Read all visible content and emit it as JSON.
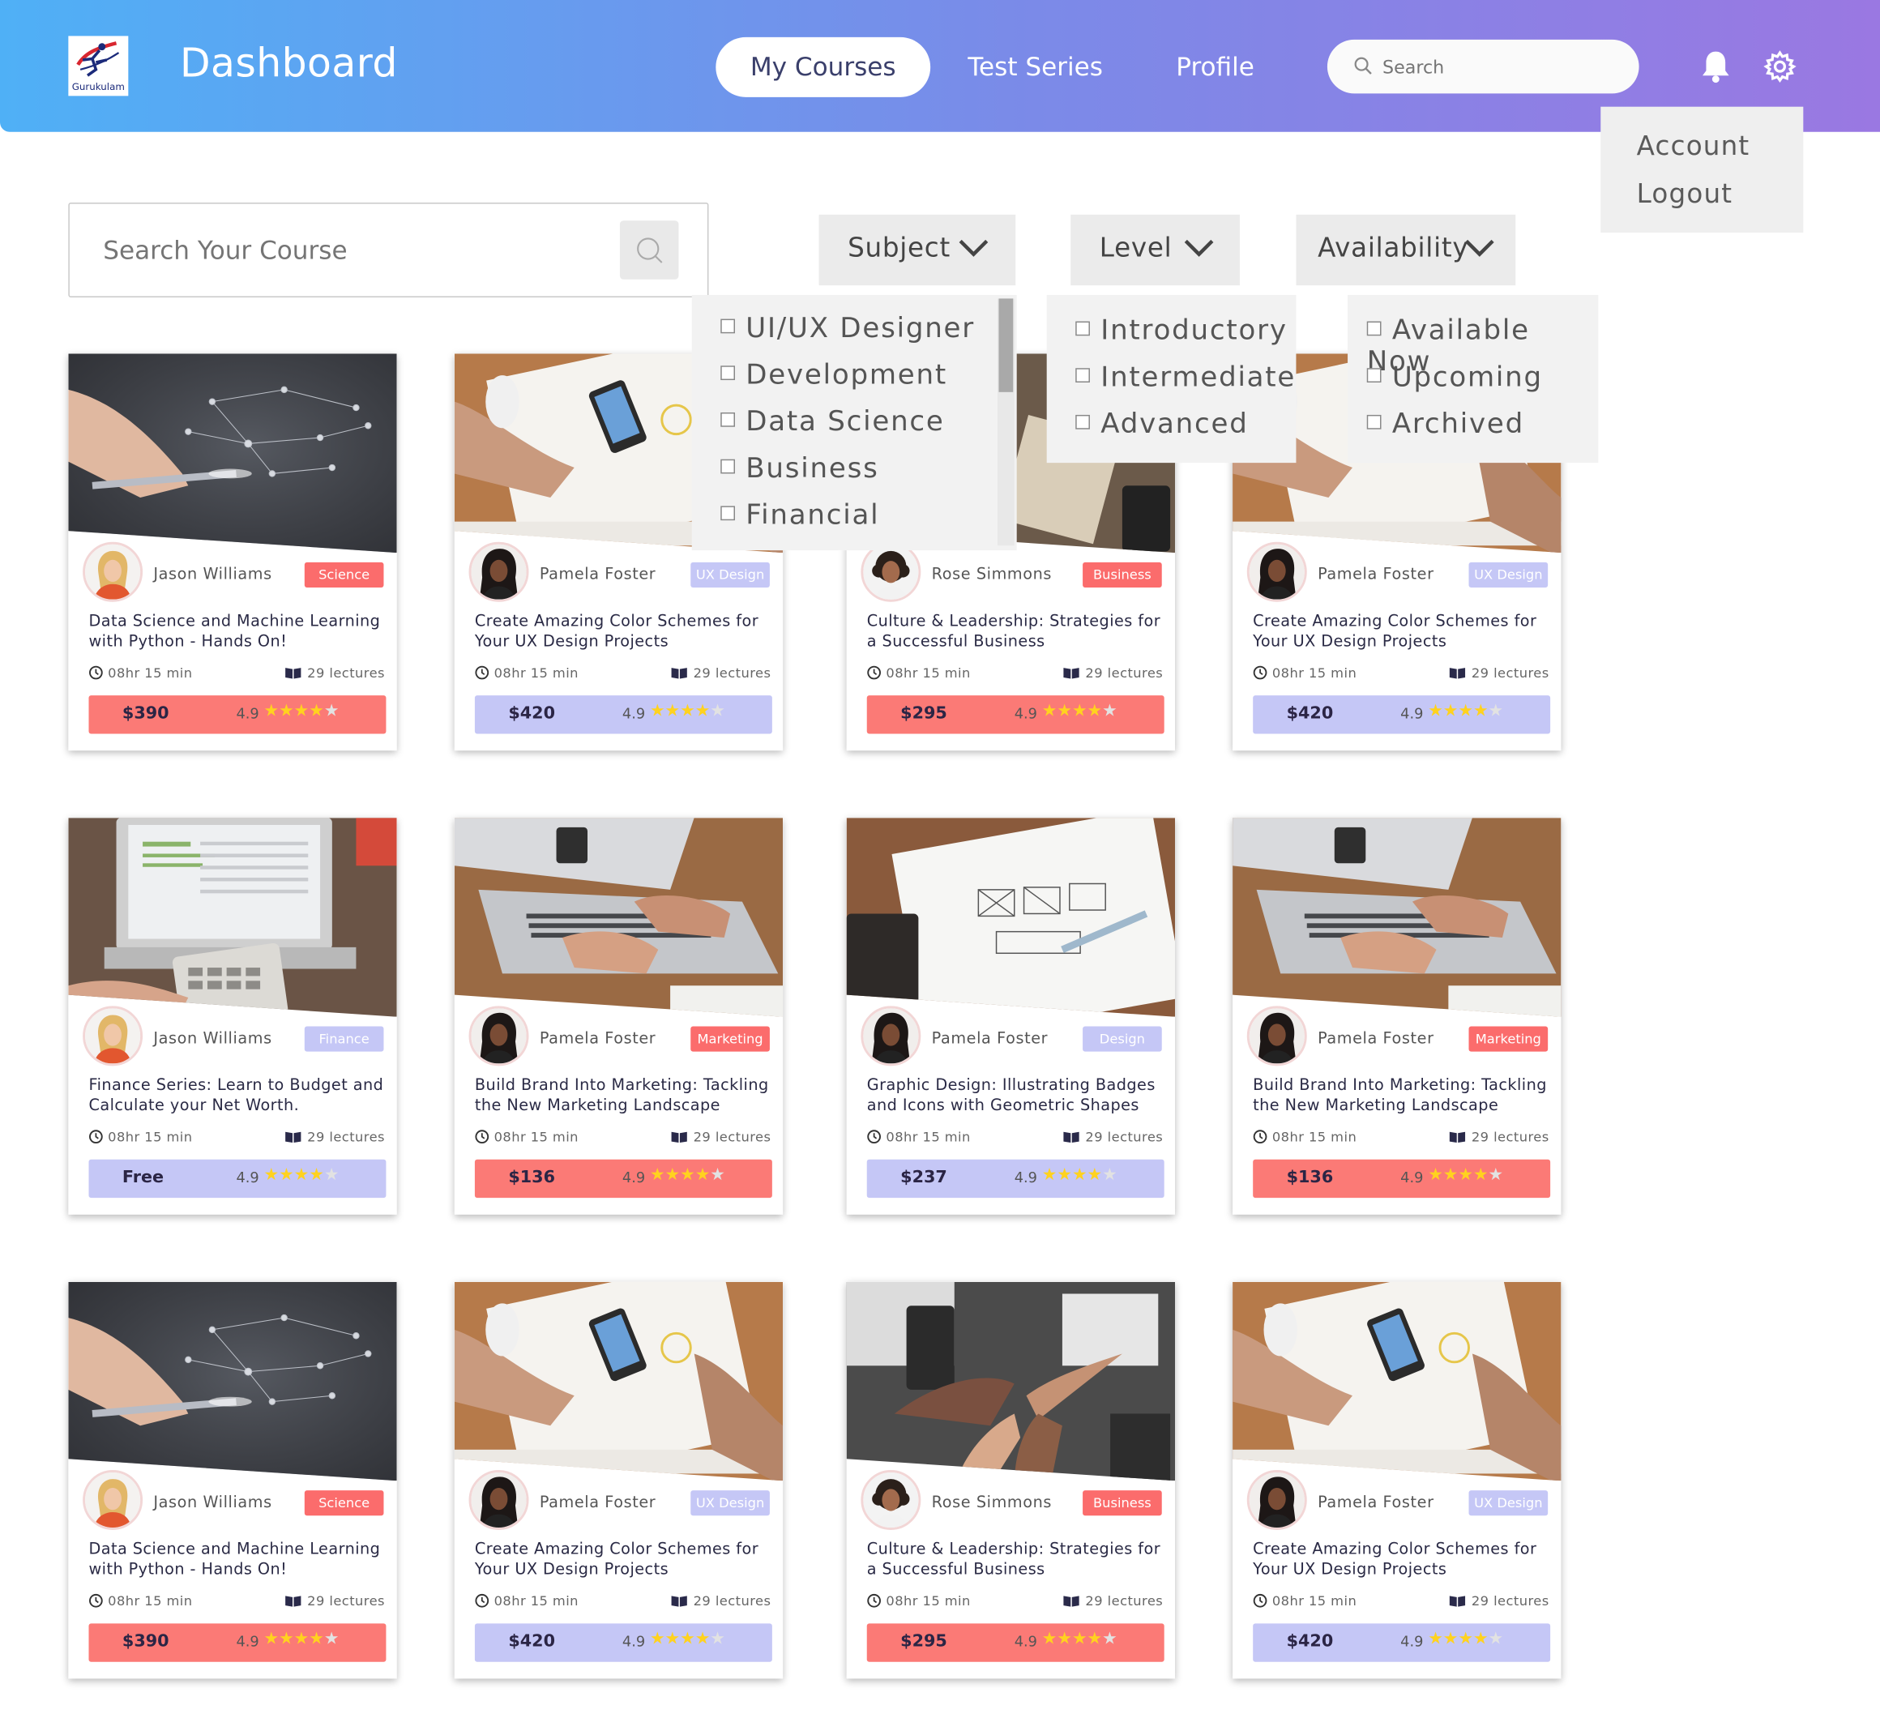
{
  "header": {
    "logo_text": "Gurukulam",
    "title": "Dashboard",
    "nav": [
      "My Courses",
      "Test Series",
      "Profile"
    ],
    "search_placeholder": "Search",
    "icons": [
      "bell-icon",
      "gear-icon"
    ]
  },
  "account_menu": [
    "Account",
    "Logout"
  ],
  "course_search": {
    "placeholder": "Search Your Course"
  },
  "filters": {
    "subject": {
      "label": "Subject",
      "options": [
        "UI/UX Designer",
        "Development",
        "Data Science",
        "Business",
        "Financial"
      ]
    },
    "level": {
      "label": "Level",
      "options": [
        "Introductory",
        "Intermediate",
        "Advanced"
      ]
    },
    "availability": {
      "label": "Availability",
      "options": [
        "Available Now",
        "Upcoming",
        "Archived"
      ]
    }
  },
  "colors": {
    "header_start": "#4fb0f6",
    "header_end": "#9a78e2",
    "tag_red": "#fb6c6c",
    "tag_lavender": "#c5c7f6",
    "price_red": "#fb7a76",
    "price_lavender": "#c5c7f6",
    "star": "#ffd21f"
  },
  "cards": [
    {
      "author": "Jason Williams",
      "tag": "Science",
      "tag_color": "red",
      "title": "Data Science and Machine Learning with Python - Hands On!",
      "duration": "08hr 15 min",
      "lectures": "29 lectures",
      "price": "$390",
      "price_color": "red",
      "rating": "4.9",
      "stars": 4,
      "image": "network",
      "avatar": "blonde"
    },
    {
      "author": "Pamela Foster",
      "tag": "UX Design",
      "tag_color": "lavender",
      "title": "Create Amazing Color Schemes for Your UX Design Projects",
      "duration": "08hr 15 min",
      "lectures": "29 lectures",
      "price": "$420",
      "price_color": "lavender",
      "rating": "4.9",
      "stars": 4,
      "image": "desk",
      "avatar": "dark"
    },
    {
      "author": "Rose Simmons",
      "tag": "Business",
      "tag_color": "red",
      "title": "Culture & Leadership: Strategies for a Successful Business",
      "duration": "08hr 15 min",
      "lectures": "29 lectures",
      "price": "$295",
      "price_color": "red",
      "rating": "4.9",
      "stars": 4,
      "image": "tablet",
      "avatar": "curly"
    },
    {
      "author": "Pamela Foster",
      "tag": "UX Design",
      "tag_color": "lavender",
      "title": "Create Amazing Color Schemes for Your UX Design Projects",
      "duration": "08hr 15 min",
      "lectures": "29 lectures",
      "price": "$420",
      "price_color": "lavender",
      "rating": "4.9",
      "stars": 4,
      "image": "desk",
      "avatar": "dark"
    },
    {
      "author": "Jason Williams",
      "tag": "Finance",
      "tag_color": "lavender",
      "title": "Finance Series: Learn to Budget and Calculate your Net Worth.",
      "duration": "08hr 15 min",
      "lectures": "29 lectures",
      "price": "Free",
      "price_color": "lavender",
      "rating": "4.9",
      "stars": 4,
      "image": "finance",
      "avatar": "blonde"
    },
    {
      "author": "Pamela Foster",
      "tag": "Marketing",
      "tag_color": "red",
      "title": "Build Brand Into Marketing: Tackling the New Marketing Landscape",
      "duration": "08hr 15 min",
      "lectures": "29 lectures",
      "price": "$136",
      "price_color": "red",
      "rating": "4.9",
      "stars": 4,
      "image": "laptop",
      "avatar": "dark"
    },
    {
      "author": "Pamela Foster",
      "tag": "Design",
      "tag_color": "lavender",
      "title": "Graphic Design: Illustrating Badges and Icons with Geometric Shapes",
      "duration": "08hr 15 min",
      "lectures": "29 lectures",
      "price": "$237",
      "price_color": "lavender",
      "rating": "4.9",
      "stars": 4,
      "image": "sketch",
      "avatar": "dark"
    },
    {
      "author": "Pamela Foster",
      "tag": "Marketing",
      "tag_color": "red",
      "title": "Build Brand Into Marketing: Tackling the New Marketing Landscape",
      "duration": "08hr 15 min",
      "lectures": "29 lectures",
      "price": "$136",
      "price_color": "red",
      "rating": "4.9",
      "stars": 4,
      "image": "laptop",
      "avatar": "dark"
    },
    {
      "author": "Jason Williams",
      "tag": "Science",
      "tag_color": "red",
      "title": "Data Science and Machine Learning with Python - Hands On!",
      "duration": "08hr 15 min",
      "lectures": "29 lectures",
      "price": "$390",
      "price_color": "red",
      "rating": "4.9",
      "stars": 4,
      "image": "network",
      "avatar": "blonde"
    },
    {
      "author": "Pamela Foster",
      "tag": "UX Design",
      "tag_color": "lavender",
      "title": "Create Amazing Color Schemes for Your UX Design Projects",
      "duration": "08hr 15 min",
      "lectures": "29 lectures",
      "price": "$420",
      "price_color": "lavender",
      "rating": "4.9",
      "stars": 4,
      "image": "desk",
      "avatar": "dark"
    },
    {
      "author": "Rose Simmons",
      "tag": "Business",
      "tag_color": "red",
      "title": "Culture & Leadership: Strategies for a Successful Business",
      "duration": "08hr 15 min",
      "lectures": "29 lectures",
      "price": "$295",
      "price_color": "red",
      "rating": "4.9",
      "stars": 4,
      "image": "fists",
      "avatar": "curly"
    },
    {
      "author": "Pamela Foster",
      "tag": "UX Design",
      "tag_color": "lavender",
      "title": "Create Amazing Color Schemes for Your UX Design Projects",
      "duration": "08hr 15 min",
      "lectures": "29 lectures",
      "price": "$420",
      "price_color": "lavender",
      "rating": "4.9",
      "stars": 4,
      "image": "desk",
      "avatar": "dark"
    }
  ]
}
